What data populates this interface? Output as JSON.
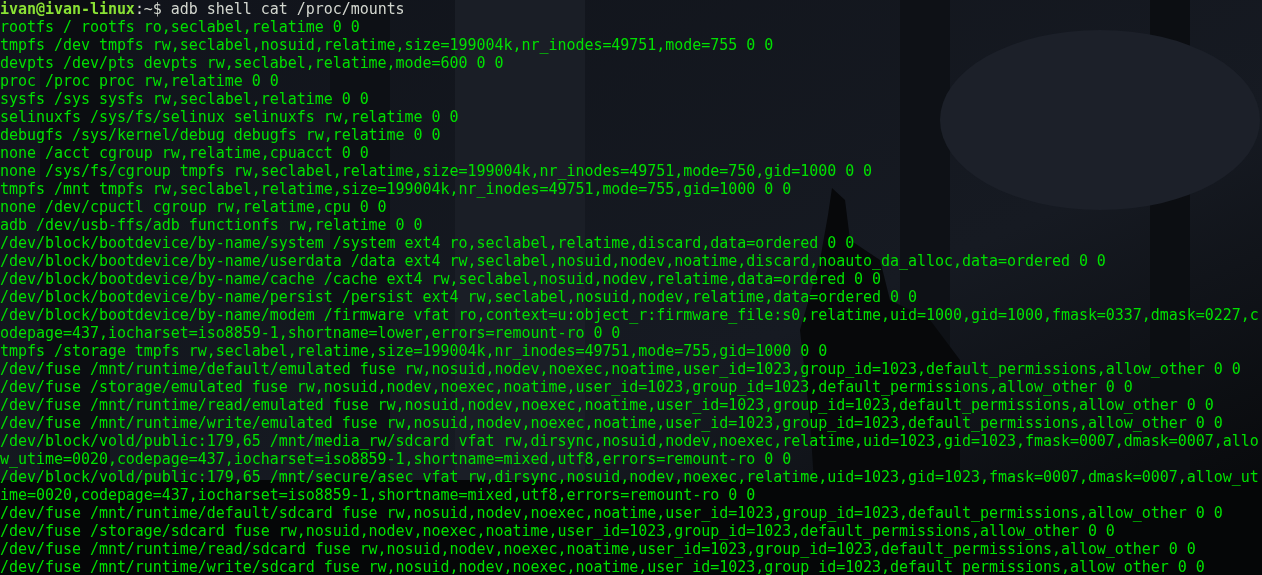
{
  "terminal": {
    "prompt": {
      "user_host": "ivan@ivan-linux",
      "path": ":~$",
      "command": "adb shell cat /proc/mounts"
    },
    "output_lines": [
      "rootfs / rootfs ro,seclabel,relatime 0 0",
      "tmpfs /dev tmpfs rw,seclabel,nosuid,relatime,size=199004k,nr_inodes=49751,mode=755 0 0",
      "devpts /dev/pts devpts rw,seclabel,relatime,mode=600 0 0",
      "proc /proc proc rw,relatime 0 0",
      "sysfs /sys sysfs rw,seclabel,relatime 0 0",
      "selinuxfs /sys/fs/selinux selinuxfs rw,relatime 0 0",
      "debugfs /sys/kernel/debug debugfs rw,relatime 0 0",
      "none /acct cgroup rw,relatime,cpuacct 0 0",
      "none /sys/fs/cgroup tmpfs rw,seclabel,relatime,size=199004k,nr_inodes=49751,mode=750,gid=1000 0 0",
      "tmpfs /mnt tmpfs rw,seclabel,relatime,size=199004k,nr_inodes=49751,mode=755,gid=1000 0 0",
      "none /dev/cpuctl cgroup rw,relatime,cpu 0 0",
      "adb /dev/usb-ffs/adb functionfs rw,relatime 0 0",
      "/dev/block/bootdevice/by-name/system /system ext4 ro,seclabel,relatime,discard,data=ordered 0 0",
      "/dev/block/bootdevice/by-name/userdata /data ext4 rw,seclabel,nosuid,nodev,noatime,discard,noauto_da_alloc,data=ordered 0 0",
      "/dev/block/bootdevice/by-name/cache /cache ext4 rw,seclabel,nosuid,nodev,relatime,data=ordered 0 0",
      "/dev/block/bootdevice/by-name/persist /persist ext4 rw,seclabel,nosuid,nodev,relatime,data=ordered 0 0",
      "/dev/block/bootdevice/by-name/modem /firmware vfat ro,context=u:object_r:firmware_file:s0,relatime,uid=1000,gid=1000,fmask=0337,dmask=0227,c",
      "odepage=437,iocharset=iso8859-1,shortname=lower,errors=remount-ro 0 0",
      "tmpfs /storage tmpfs rw,seclabel,relatime,size=199004k,nr_inodes=49751,mode=755,gid=1000 0 0",
      "/dev/fuse /mnt/runtime/default/emulated fuse rw,nosuid,nodev,noexec,noatime,user_id=1023,group_id=1023,default_permissions,allow_other 0 0",
      "/dev/fuse /storage/emulated fuse rw,nosuid,nodev,noexec,noatime,user_id=1023,group_id=1023,default_permissions,allow_other 0 0",
      "/dev/fuse /mnt/runtime/read/emulated fuse rw,nosuid,nodev,noexec,noatime,user_id=1023,group_id=1023,default_permissions,allow_other 0 0",
      "/dev/fuse /mnt/runtime/write/emulated fuse rw,nosuid,nodev,noexec,noatime,user_id=1023,group_id=1023,default_permissions,allow_other 0 0",
      "/dev/block/vold/public:179,65 /mnt/media_rw/sdcard vfat rw,dirsync,nosuid,nodev,noexec,relatime,uid=1023,gid=1023,fmask=0007,dmask=0007,allo",
      "w_utime=0020,codepage=437,iocharset=iso8859-1,shortname=mixed,utf8,errors=remount-ro 0 0",
      "/dev/block/vold/public:179,65 /mnt/secure/asec vfat rw,dirsync,nosuid,nodev,noexec,relatime,uid=1023,gid=1023,fmask=0007,dmask=0007,allow_ut",
      "ime=0020,codepage=437,iocharset=iso8859-1,shortname=mixed,utf8,errors=remount-ro 0 0",
      "/dev/fuse /mnt/runtime/default/sdcard fuse rw,nosuid,nodev,noexec,noatime,user_id=1023,group_id=1023,default_permissions,allow_other 0 0",
      "/dev/fuse /storage/sdcard fuse rw,nosuid,nodev,noexec,noatime,user_id=1023,group_id=1023,default_permissions,allow_other 0 0",
      "/dev/fuse /mnt/runtime/read/sdcard fuse rw,nosuid,nodev,noexec,noatime,user_id=1023,group_id=1023,default_permissions,allow_other 0 0",
      "/dev/fuse /mnt/runtime/write/sdcard fuse rw,nosuid,nodev,noexec,noatime,user_id=1023,group_id=1023,default_permissions,allow_other 0 0"
    ]
  }
}
